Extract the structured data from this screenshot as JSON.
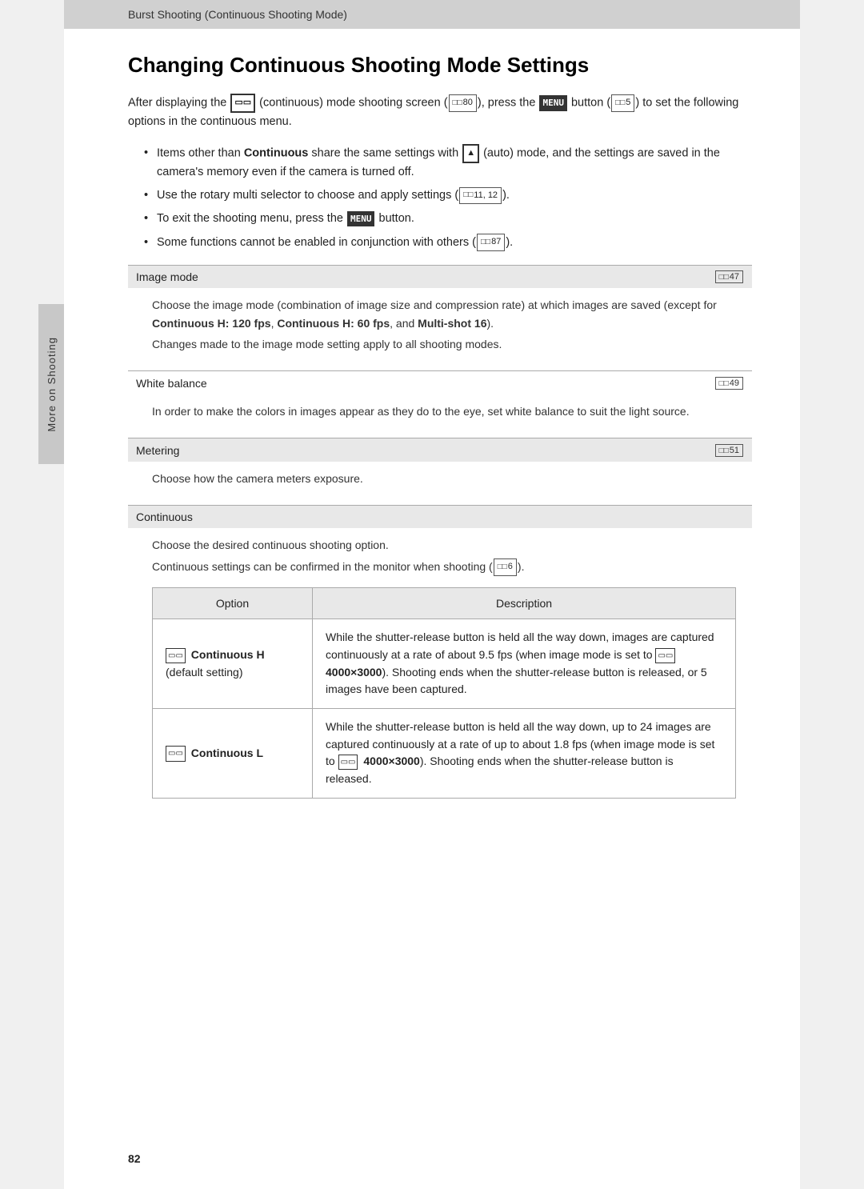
{
  "header": {
    "breadcrumb": "Burst Shooting (Continuous Shooting Mode)"
  },
  "page": {
    "title": "Changing Continuous Shooting Mode Settings",
    "intro_line1": "After displaying the  (continuous) mode shooting screen (",
    "intro_ref1": "80",
    "intro_line1b": "), press the",
    "intro_line2_start": " button (",
    "intro_ref2": "5",
    "intro_line2b": ") to set the following options in the continuous menu.",
    "bullets": [
      {
        "text_parts": [
          {
            "text": "Items other than ",
            "bold": false
          },
          {
            "text": "Continuous",
            "bold": true
          },
          {
            "text": " share the same settings with  (auto) mode, and the settings are saved in the camera’s memory even if the camera is turned off.",
            "bold": false
          }
        ]
      },
      {
        "text_parts": [
          {
            "text": "Use the rotary multi selector to choose and apply settings (",
            "bold": false
          },
          {
            "text": "11, 12",
            "bold": false,
            "ref": true
          },
          {
            "text": ").",
            "bold": false
          }
        ]
      },
      {
        "text_parts": [
          {
            "text": "To exit the shooting menu, press the ",
            "bold": false
          },
          {
            "text": "MENU",
            "bold": true,
            "menuIcon": true
          },
          {
            "text": " button.",
            "bold": false
          }
        ]
      },
      {
        "text_parts": [
          {
            "text": "Some functions cannot be enabled in conjunction with others (",
            "bold": false
          },
          {
            "text": "87",
            "bold": false,
            "ref": true
          },
          {
            "text": ").",
            "bold": false
          }
        ]
      }
    ],
    "sections": [
      {
        "id": "image-mode",
        "title": "Image mode",
        "ref": "47",
        "bg": "gray",
        "description_parts": [
          "Choose the image mode (combination of image size and compression rate) at which images are saved (except for ",
          {
            "bold": true,
            "text": "Continuous H: 120 fps"
          },
          ", ",
          {
            "bold": true,
            "text": "Continuous H: 60 fps"
          },
          ", and ",
          {
            "bold": true,
            "text": "Multi-shot 16"
          },
          ").",
          "\nChanges made to the image mode setting apply to all shooting modes."
        ]
      },
      {
        "id": "white-balance",
        "title": "White balance",
        "ref": "49",
        "bg": "white",
        "description": "In order to make the colors in images appear as they do to the eye, set white balance to suit the light source."
      },
      {
        "id": "metering",
        "title": "Metering",
        "ref": "51",
        "bg": "gray",
        "description": "Choose how the camera meters exposure."
      },
      {
        "id": "continuous",
        "title": "Continuous",
        "ref": null,
        "bg": "gray",
        "description_lines": [
          "Choose the desired continuous shooting option.",
          "Continuous settings can be confirmed in the monitor when shooting (□□ 6)."
        ]
      }
    ],
    "table": {
      "headers": [
        "Option",
        "Description"
      ],
      "rows": [
        {
          "option": "Continuous H\n(default setting)",
          "description": "While the shutter-release button is held all the way down, images are captured continuously at a rate of about 9.5 fps (when image mode is set to  4000×3000). Shooting ends when the shutter-release button is released, or 5 images have been captured."
        },
        {
          "option": "Continuous L",
          "description": "While the shutter-release button is held all the way down, up to 24 images are captured continuously at a rate of up to about 1.8 fps (when image mode is set to  4000×3000). Shooting ends when the shutter-release button is released."
        }
      ]
    },
    "side_tab": "More on Shooting",
    "page_number": "82"
  }
}
